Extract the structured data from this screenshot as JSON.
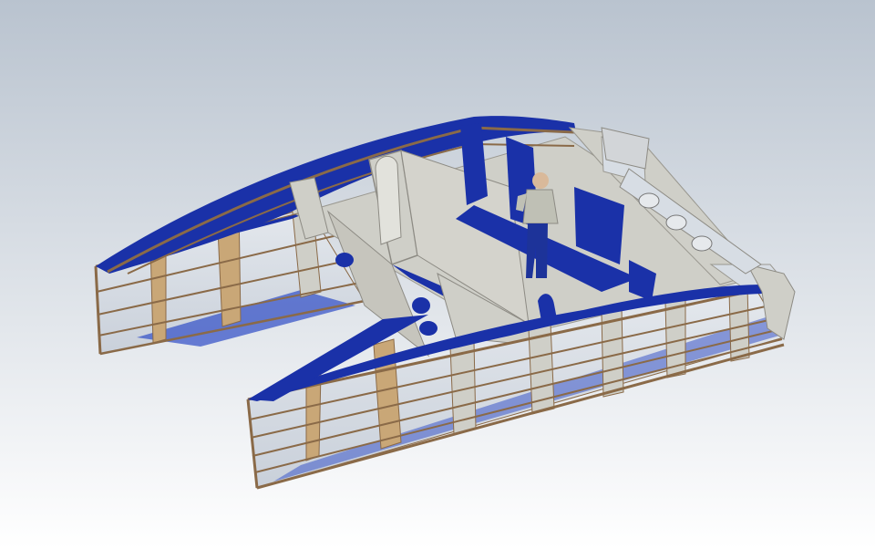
{
  "scene": {
    "subject": "catamaran-hull-frame-model",
    "colors": {
      "background_top": "#b9c3cf",
      "background_bottom": "#ffffff",
      "deck_blue": "#1a31a8",
      "deck_blue_light": "#2c48c2",
      "bulkhead_grey": "#cfcfc8",
      "bulkhead_shade": "#b5b4ac",
      "plywood": "#c9a777",
      "stringer_brown": "#8a6a48",
      "glass_panel": "#d7dde4",
      "figure_shirt": "#bfc0b5",
      "figure_pants": "#1d3399",
      "figure_skin": "#d9b99a"
    }
  }
}
